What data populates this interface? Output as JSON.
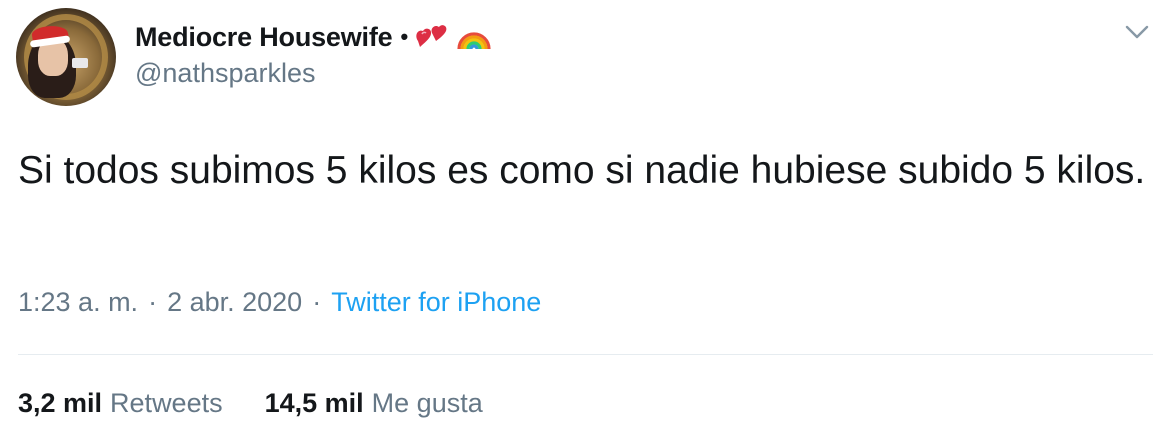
{
  "tweet": {
    "display_name": "Mediocre Housewife",
    "name_separator": "•",
    "emojis": [
      "two-hearts-icon",
      "rainbow-icon"
    ],
    "handle": "@nathsparkles",
    "text": "Si todos subimos 5 kilos es como si nadie hubiese subido 5 kilos.",
    "time": "1:23 a. m.",
    "date": "2 abr. 2020",
    "separator": "·",
    "source": "Twitter for iPhone",
    "retweets_count": "3,2 mil",
    "retweets_label": "Retweets",
    "likes_count": "14,5 mil",
    "likes_label": "Me gusta"
  },
  "colors": {
    "text_primary": "#14171a",
    "text_secondary": "#657786",
    "link": "#1da1f2",
    "divider": "#e6ecf0"
  }
}
